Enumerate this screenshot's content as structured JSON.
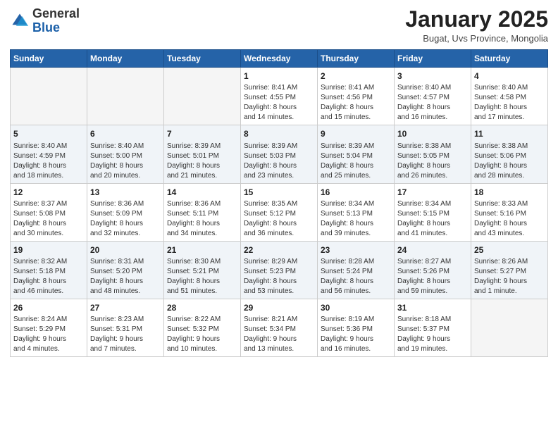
{
  "logo": {
    "general": "General",
    "blue": "Blue"
  },
  "header": {
    "title": "January 2025",
    "subtitle": "Bugat, Uvs Province, Mongolia"
  },
  "weekdays": [
    "Sunday",
    "Monday",
    "Tuesday",
    "Wednesday",
    "Thursday",
    "Friday",
    "Saturday"
  ],
  "weeks": [
    [
      {
        "day": "",
        "info": ""
      },
      {
        "day": "",
        "info": ""
      },
      {
        "day": "",
        "info": ""
      },
      {
        "day": "1",
        "info": "Sunrise: 8:41 AM\nSunset: 4:55 PM\nDaylight: 8 hours\nand 14 minutes."
      },
      {
        "day": "2",
        "info": "Sunrise: 8:41 AM\nSunset: 4:56 PM\nDaylight: 8 hours\nand 15 minutes."
      },
      {
        "day": "3",
        "info": "Sunrise: 8:40 AM\nSunset: 4:57 PM\nDaylight: 8 hours\nand 16 minutes."
      },
      {
        "day": "4",
        "info": "Sunrise: 8:40 AM\nSunset: 4:58 PM\nDaylight: 8 hours\nand 17 minutes."
      }
    ],
    [
      {
        "day": "5",
        "info": "Sunrise: 8:40 AM\nSunset: 4:59 PM\nDaylight: 8 hours\nand 18 minutes."
      },
      {
        "day": "6",
        "info": "Sunrise: 8:40 AM\nSunset: 5:00 PM\nDaylight: 8 hours\nand 20 minutes."
      },
      {
        "day": "7",
        "info": "Sunrise: 8:39 AM\nSunset: 5:01 PM\nDaylight: 8 hours\nand 21 minutes."
      },
      {
        "day": "8",
        "info": "Sunrise: 8:39 AM\nSunset: 5:03 PM\nDaylight: 8 hours\nand 23 minutes."
      },
      {
        "day": "9",
        "info": "Sunrise: 8:39 AM\nSunset: 5:04 PM\nDaylight: 8 hours\nand 25 minutes."
      },
      {
        "day": "10",
        "info": "Sunrise: 8:38 AM\nSunset: 5:05 PM\nDaylight: 8 hours\nand 26 minutes."
      },
      {
        "day": "11",
        "info": "Sunrise: 8:38 AM\nSunset: 5:06 PM\nDaylight: 8 hours\nand 28 minutes."
      }
    ],
    [
      {
        "day": "12",
        "info": "Sunrise: 8:37 AM\nSunset: 5:08 PM\nDaylight: 8 hours\nand 30 minutes."
      },
      {
        "day": "13",
        "info": "Sunrise: 8:36 AM\nSunset: 5:09 PM\nDaylight: 8 hours\nand 32 minutes."
      },
      {
        "day": "14",
        "info": "Sunrise: 8:36 AM\nSunset: 5:11 PM\nDaylight: 8 hours\nand 34 minutes."
      },
      {
        "day": "15",
        "info": "Sunrise: 8:35 AM\nSunset: 5:12 PM\nDaylight: 8 hours\nand 36 minutes."
      },
      {
        "day": "16",
        "info": "Sunrise: 8:34 AM\nSunset: 5:13 PM\nDaylight: 8 hours\nand 39 minutes."
      },
      {
        "day": "17",
        "info": "Sunrise: 8:34 AM\nSunset: 5:15 PM\nDaylight: 8 hours\nand 41 minutes."
      },
      {
        "day": "18",
        "info": "Sunrise: 8:33 AM\nSunset: 5:16 PM\nDaylight: 8 hours\nand 43 minutes."
      }
    ],
    [
      {
        "day": "19",
        "info": "Sunrise: 8:32 AM\nSunset: 5:18 PM\nDaylight: 8 hours\nand 46 minutes."
      },
      {
        "day": "20",
        "info": "Sunrise: 8:31 AM\nSunset: 5:20 PM\nDaylight: 8 hours\nand 48 minutes."
      },
      {
        "day": "21",
        "info": "Sunrise: 8:30 AM\nSunset: 5:21 PM\nDaylight: 8 hours\nand 51 minutes."
      },
      {
        "day": "22",
        "info": "Sunrise: 8:29 AM\nSunset: 5:23 PM\nDaylight: 8 hours\nand 53 minutes."
      },
      {
        "day": "23",
        "info": "Sunrise: 8:28 AM\nSunset: 5:24 PM\nDaylight: 8 hours\nand 56 minutes."
      },
      {
        "day": "24",
        "info": "Sunrise: 8:27 AM\nSunset: 5:26 PM\nDaylight: 8 hours\nand 59 minutes."
      },
      {
        "day": "25",
        "info": "Sunrise: 8:26 AM\nSunset: 5:27 PM\nDaylight: 9 hours\nand 1 minute."
      }
    ],
    [
      {
        "day": "26",
        "info": "Sunrise: 8:24 AM\nSunset: 5:29 PM\nDaylight: 9 hours\nand 4 minutes."
      },
      {
        "day": "27",
        "info": "Sunrise: 8:23 AM\nSunset: 5:31 PM\nDaylight: 9 hours\nand 7 minutes."
      },
      {
        "day": "28",
        "info": "Sunrise: 8:22 AM\nSunset: 5:32 PM\nDaylight: 9 hours\nand 10 minutes."
      },
      {
        "day": "29",
        "info": "Sunrise: 8:21 AM\nSunset: 5:34 PM\nDaylight: 9 hours\nand 13 minutes."
      },
      {
        "day": "30",
        "info": "Sunrise: 8:19 AM\nSunset: 5:36 PM\nDaylight: 9 hours\nand 16 minutes."
      },
      {
        "day": "31",
        "info": "Sunrise: 8:18 AM\nSunset: 5:37 PM\nDaylight: 9 hours\nand 19 minutes."
      },
      {
        "day": "",
        "info": ""
      }
    ]
  ]
}
